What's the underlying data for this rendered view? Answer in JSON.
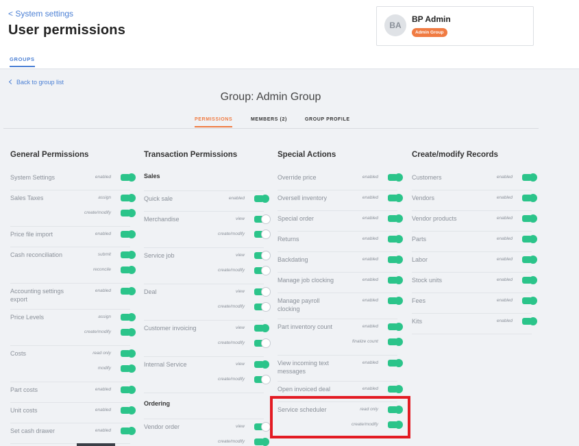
{
  "header": {
    "back_label": "< System settings",
    "title": "User permissions",
    "tab_groups": "GROUPS"
  },
  "user": {
    "initials": "BA",
    "name": "BP Admin",
    "group_badge": "Admin Group"
  },
  "group": {
    "back_label": "Back to group list",
    "title": "Group: Admin Group",
    "tabs": [
      "PERMISSIONS",
      "MEMBERS (2)",
      "GROUP PROFILE"
    ]
  },
  "columns": [
    {
      "title": "General Permissions",
      "items": [
        {
          "label": "System Settings",
          "toggles": [
            {
              "label": "enabled",
              "on": true
            }
          ]
        },
        {
          "label": "Sales Taxes",
          "toggles": [
            {
              "label": "assign",
              "on": true
            },
            {
              "label": "create/modify",
              "on": true
            }
          ]
        },
        {
          "label": "Price file import",
          "toggles": [
            {
              "label": "enabled",
              "on": true
            }
          ]
        },
        {
          "label": "Cash reconciliation",
          "toggles": [
            {
              "label": "submit",
              "on": true
            },
            {
              "label": "reconcile",
              "on": true
            }
          ]
        },
        {
          "label": "Accounting settings export",
          "toggles": [
            {
              "label": "enabled",
              "on": true
            }
          ]
        },
        {
          "label": "Price Levels",
          "toggles": [
            {
              "label": "assign",
              "on": true
            },
            {
              "label": "create/modify",
              "on": true
            }
          ]
        },
        {
          "label": "Costs",
          "toggles": [
            {
              "label": "read only",
              "on": true
            },
            {
              "label": "modify",
              "on": true
            }
          ]
        },
        {
          "label": "Part costs",
          "toggles": [
            {
              "label": "enabled",
              "on": true
            }
          ]
        },
        {
          "label": "Unit costs",
          "toggles": [
            {
              "label": "enabled",
              "on": true
            }
          ]
        },
        {
          "label": "Set cash drawer",
          "toggles": [
            {
              "label": "enabled",
              "on": true
            }
          ]
        }
      ]
    },
    {
      "title": "Transaction Permissions",
      "sections": [
        {
          "title": "Sales",
          "items": [
            {
              "label": "Quick sale",
              "toggles": [
                {
                  "label": "enabled",
                  "on": true
                }
              ]
            },
            {
              "label": "Merchandise",
              "toggles": [
                {
                  "label": "view",
                  "on": false
                },
                {
                  "label": "create/modify",
                  "on": false
                }
              ]
            },
            {
              "label": "Service job",
              "toggles": [
                {
                  "label": "view",
                  "on": false
                },
                {
                  "label": "create/modify",
                  "on": false
                }
              ]
            },
            {
              "label": "Deal",
              "toggles": [
                {
                  "label": "view",
                  "on": false
                },
                {
                  "label": "create/modify",
                  "on": false
                }
              ]
            },
            {
              "label": "Customer invoicing",
              "toggles": [
                {
                  "label": "view",
                  "on": true
                },
                {
                  "label": "create/modify",
                  "on": false
                }
              ]
            },
            {
              "label": "Internal Service",
              "toggles": [
                {
                  "label": "view",
                  "on": true
                },
                {
                  "label": "create/modify",
                  "on": false
                }
              ]
            }
          ]
        },
        {
          "title": "Ordering",
          "items": [
            {
              "label": "Vendor order",
              "toggles": [
                {
                  "label": "view",
                  "on": false
                },
                {
                  "label": "create/modify",
                  "on": true
                }
              ]
            }
          ]
        }
      ]
    },
    {
      "title": "Special Actions",
      "items": [
        {
          "label": "Override price",
          "toggles": [
            {
              "label": "enabled",
              "on": true
            }
          ]
        },
        {
          "label": "Oversell inventory",
          "toggles": [
            {
              "label": "enabled",
              "on": true
            }
          ]
        },
        {
          "label": "Special order",
          "toggles": [
            {
              "label": "enabled",
              "on": true
            }
          ]
        },
        {
          "label": "Returns",
          "toggles": [
            {
              "label": "enabled",
              "on": true
            }
          ]
        },
        {
          "label": "Backdating",
          "toggles": [
            {
              "label": "enabled",
              "on": true
            }
          ]
        },
        {
          "label": "Manage job clocking",
          "toggles": [
            {
              "label": "enabled",
              "on": true
            }
          ]
        },
        {
          "label": "Manage payroll clocking",
          "toggles": [
            {
              "label": "enabled",
              "on": true
            }
          ]
        },
        {
          "label": "Part inventory count",
          "toggles": [
            {
              "label": "enabled",
              "on": true
            },
            {
              "label": "finalize count",
              "on": true
            }
          ]
        },
        {
          "label": "View incoming text messages",
          "toggles": [
            {
              "label": "enabled",
              "on": true
            }
          ]
        },
        {
          "label": "Open invoiced deal",
          "toggles": [
            {
              "label": "enabled",
              "on": true
            }
          ]
        },
        {
          "label": "Service scheduler",
          "toggles": [
            {
              "label": "read only",
              "on": true
            },
            {
              "label": "create/modify",
              "on": true
            }
          ]
        }
      ]
    },
    {
      "title": "Create/modify Records",
      "items": [
        {
          "label": "Customers",
          "toggles": [
            {
              "label": "enabled",
              "on": true
            }
          ]
        },
        {
          "label": "Vendors",
          "toggles": [
            {
              "label": "enabled",
              "on": true
            }
          ]
        },
        {
          "label": "Vendor products",
          "toggles": [
            {
              "label": "enabled",
              "on": true
            }
          ]
        },
        {
          "label": "Parts",
          "toggles": [
            {
              "label": "enabled",
              "on": true
            }
          ]
        },
        {
          "label": "Labor",
          "toggles": [
            {
              "label": "enabled",
              "on": true
            }
          ]
        },
        {
          "label": "Stock units",
          "toggles": [
            {
              "label": "enabled",
              "on": true
            }
          ]
        },
        {
          "label": "Fees",
          "toggles": [
            {
              "label": "enabled",
              "on": true
            }
          ]
        },
        {
          "label": "Kits",
          "toggles": [
            {
              "label": "enabled",
              "on": true
            }
          ]
        }
      ]
    }
  ],
  "colors": {
    "accent_blue": "#4a7fd4",
    "accent_orange": "#f07b42",
    "toggle_green": "#2bc48a",
    "highlight_red": "#e31b23"
  }
}
